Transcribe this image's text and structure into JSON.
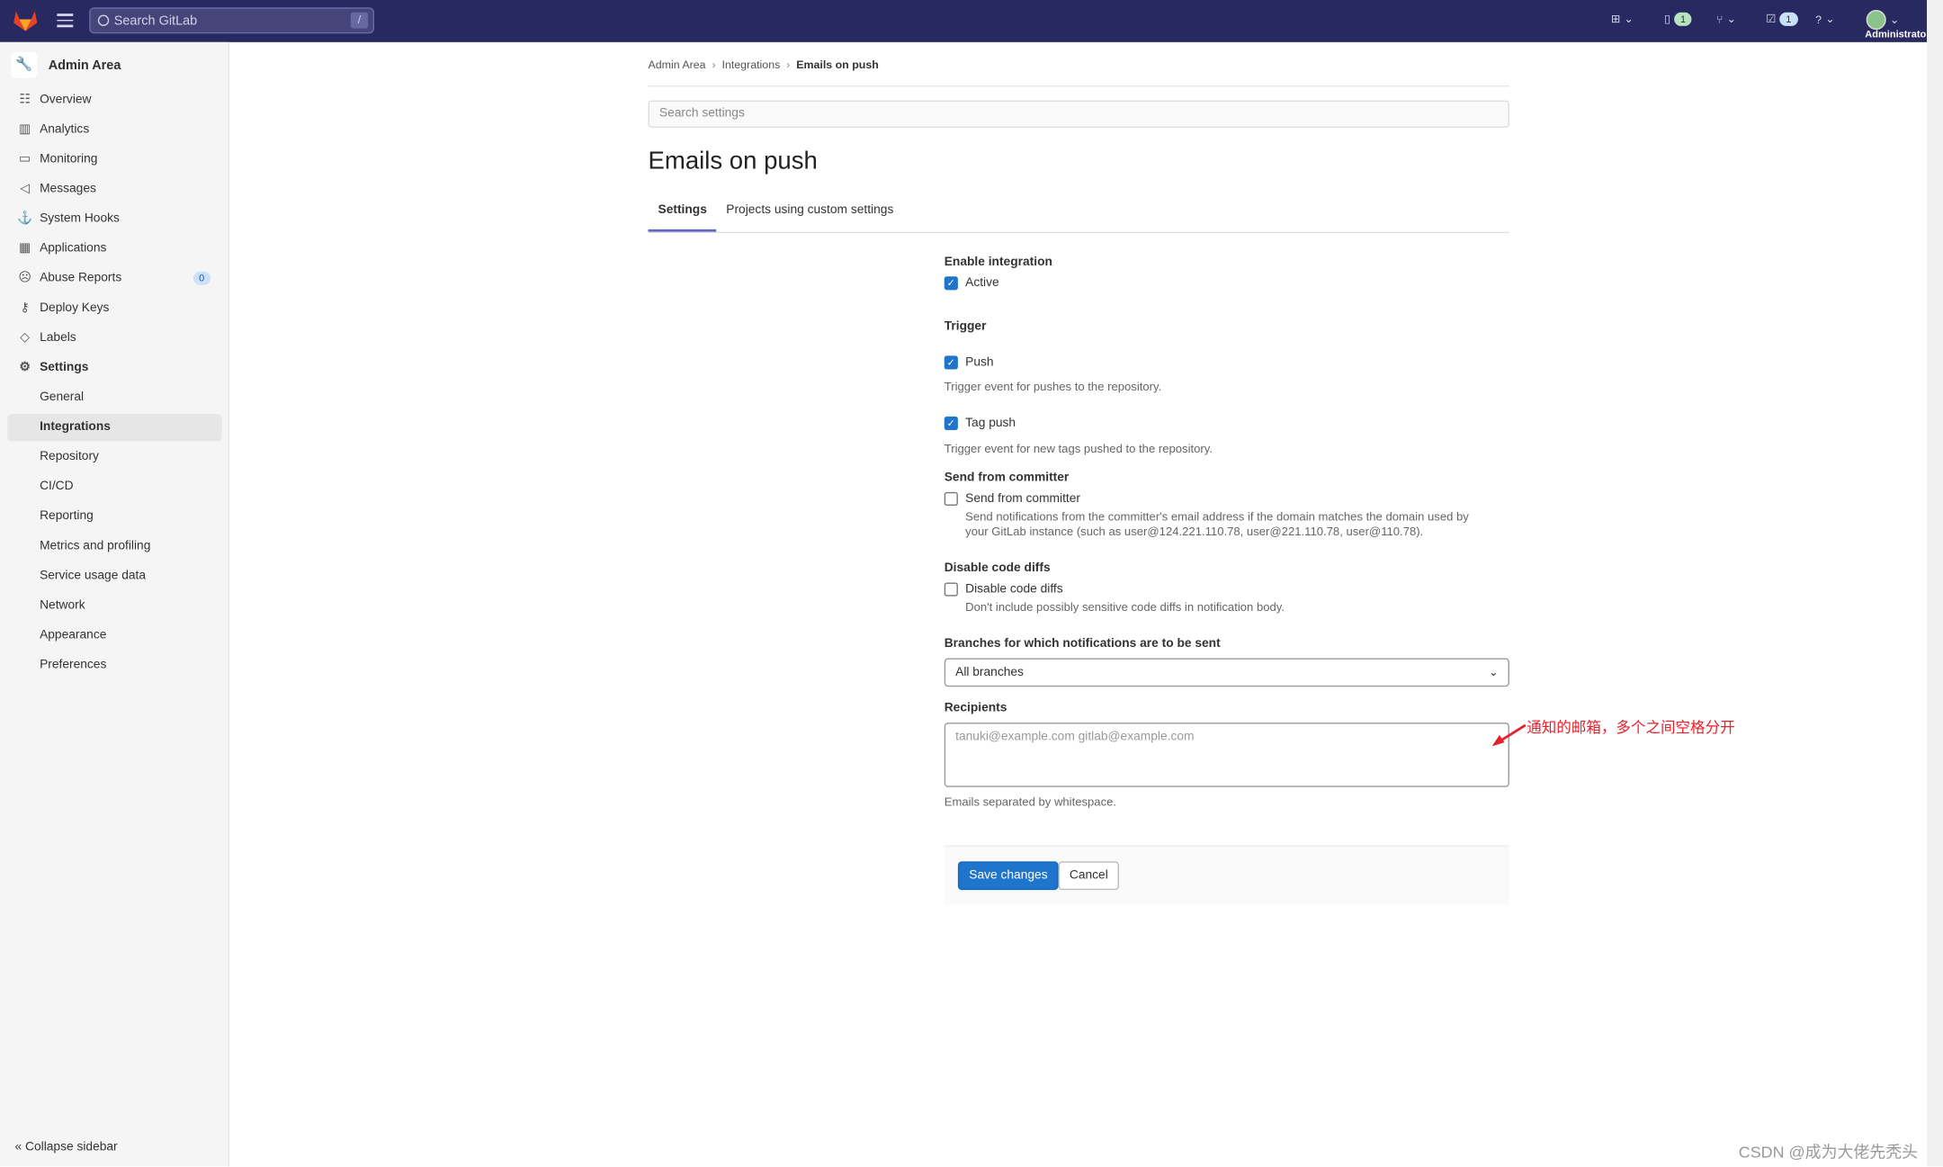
{
  "topbar": {
    "search_placeholder": "Search GitLab",
    "search_shortcut": "/",
    "issues_count": "1",
    "todos_count": "1",
    "user": "Administrator"
  },
  "sidebar": {
    "title": "Admin Area",
    "items": [
      {
        "label": "Overview",
        "icon": "overview-icon"
      },
      {
        "label": "Analytics",
        "icon": "chart-icon"
      },
      {
        "label": "Monitoring",
        "icon": "monitor-icon"
      },
      {
        "label": "Messages",
        "icon": "megaphone-icon"
      },
      {
        "label": "System Hooks",
        "icon": "anchor-icon"
      },
      {
        "label": "Applications",
        "icon": "apps-icon"
      },
      {
        "label": "Abuse Reports",
        "icon": "abuse-icon",
        "count": "0"
      },
      {
        "label": "Deploy Keys",
        "icon": "key-icon"
      },
      {
        "label": "Labels",
        "icon": "label-icon"
      },
      {
        "label": "Settings",
        "icon": "gear-icon"
      }
    ],
    "sub_items": [
      "General",
      "Integrations",
      "Repository",
      "CI/CD",
      "Reporting",
      "Metrics and profiling",
      "Service usage data",
      "Network",
      "Appearance",
      "Preferences"
    ],
    "active": "Integrations",
    "collapse": "Collapse sidebar"
  },
  "breadcrumb": [
    "Admin Area",
    "Integrations",
    "Emails on push"
  ],
  "search_settings_placeholder": "Search settings",
  "page_title": "Emails on push",
  "tabs": [
    "Settings",
    "Projects using custom settings"
  ],
  "form": {
    "enable_label": "Enable integration",
    "active_label": "Active",
    "active_checked": true,
    "trigger_label": "Trigger",
    "push_label": "Push",
    "push_checked": true,
    "push_help": "Trigger event for pushes to the repository.",
    "tag_push_label": "Tag push",
    "tag_push_checked": true,
    "tag_push_help": "Trigger event for new tags pushed to the repository.",
    "committer_section": "Send from committer",
    "committer_label": "Send from committer",
    "committer_checked": false,
    "committer_help1": "Send notifications from the committer's email address if the domain matches the domain used by",
    "committer_help2": "your GitLab instance (such as user@124.221.110.78, user@221.110.78, user@110.78).",
    "diffs_section": "Disable code diffs",
    "diffs_label": "Disable code diffs",
    "diffs_checked": false,
    "diffs_help": "Don't include possibly sensitive code diffs in notification body.",
    "branches_label": "Branches for which notifications are to be sent",
    "branches_value": "All branches",
    "recipients_label": "Recipients",
    "recipients_placeholder": "tanuki@example.com gitlab@example.com",
    "recipients_help": "Emails separated by whitespace.",
    "save": "Save changes",
    "cancel": "Cancel"
  },
  "annotation": "通知的邮箱，多个之间空格分开",
  "watermark": "CSDN @成为大佬先秃头"
}
